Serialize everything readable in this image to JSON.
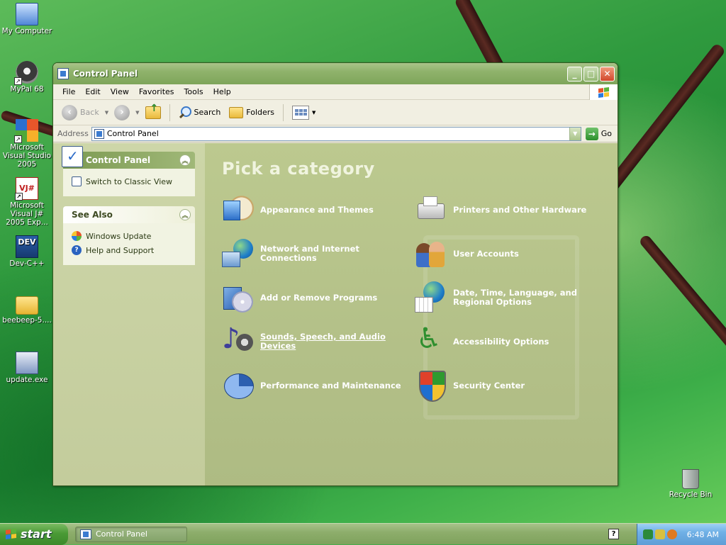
{
  "desktop": {
    "icons": [
      {
        "label": "My Computer",
        "icon": "computer-icon"
      },
      {
        "label": "MyPal 68",
        "icon": "mypal-icon"
      },
      {
        "label": "Microsoft Visual Studio 2005",
        "icon": "visual-studio-icon"
      },
      {
        "label": "Microsoft Visual J# 2005 Exp...",
        "icon": "visual-jsharp-icon"
      },
      {
        "label": "Dev-C++",
        "icon": "dev-cpp-icon"
      },
      {
        "label": "beebeep-5....",
        "icon": "folder-icon"
      },
      {
        "label": "update.exe",
        "icon": "installer-icon"
      },
      {
        "label": "Recycle Bin",
        "icon": "recycle-bin-icon"
      }
    ],
    "dev_badge": "DEV",
    "vj_badge": "VJ#"
  },
  "window": {
    "title": "Control Panel",
    "buttons": {
      "minimize": "_",
      "maximize": "□",
      "close": "✕"
    }
  },
  "menubar": {
    "items": [
      "File",
      "Edit",
      "View",
      "Favorites",
      "Tools",
      "Help"
    ]
  },
  "toolbar": {
    "back_label": "Back",
    "search_label": "Search",
    "folders_label": "Folders"
  },
  "addressbar": {
    "label": "Address",
    "value": "Control Panel",
    "go_label": "Go"
  },
  "taskpane": {
    "panel_title": "Control Panel",
    "switch_link": "Switch to Classic View",
    "see_also_title": "See Also",
    "see_also_links": [
      "Windows Update",
      "Help and Support"
    ]
  },
  "main": {
    "heading": "Pick a category",
    "categories": [
      {
        "label": "Appearance and Themes",
        "icon": "appearance-themes-icon"
      },
      {
        "label": "Printers and Other Hardware",
        "icon": "printer-icon"
      },
      {
        "label": "Network and Internet Connections",
        "icon": "network-globe-icon"
      },
      {
        "label": "User Accounts",
        "icon": "user-accounts-icon"
      },
      {
        "label": "Add or Remove Programs",
        "icon": "add-remove-programs-icon"
      },
      {
        "label": "Date, Time, Language, and Regional Options",
        "icon": "date-time-globe-icon"
      },
      {
        "label": "Sounds, Speech, and Audio Devices",
        "icon": "sound-icon"
      },
      {
        "label": "Accessibility Options",
        "icon": "accessibility-icon"
      },
      {
        "label": "Performance and Maintenance",
        "icon": "performance-icon"
      },
      {
        "label": "Security Center",
        "icon": "security-shield-icon"
      }
    ]
  },
  "taskbar": {
    "start_label": "start",
    "task_label": "Control Panel",
    "clock": "6:48 AM"
  },
  "colors": {
    "window_accent": "#8fb26b",
    "start_button": "#4a9a35",
    "tray": "#6fb0e6"
  }
}
